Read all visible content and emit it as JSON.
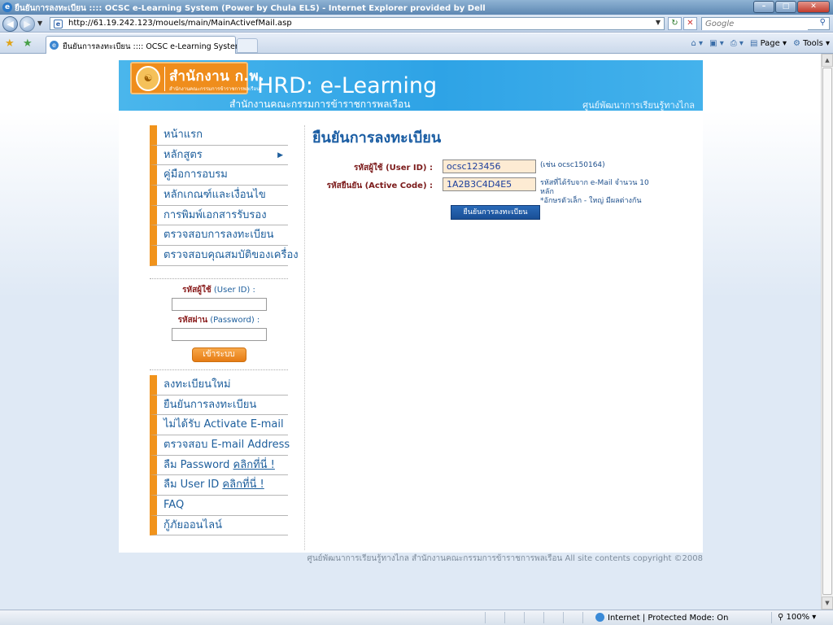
{
  "browser": {
    "window_title": "ยืนยันการลงทะเบียน :::: OCSC e-Learning System (Power by Chula ELS) - Internet Explorer provided by Dell",
    "url": "http://61.19.242.123/mouels/main/MainActivefMail.asp",
    "search_placeholder": "Google",
    "tab_title": "ยืนยันการลงทะเบียน :::: OCSC e-Learning System (...",
    "cmd_page": "Page",
    "cmd_tools": "Tools",
    "status_zone": "Internet | Protected Mode: On",
    "zoom": "100%"
  },
  "banner": {
    "logo_text": "สำนักงาน ก.พ.",
    "logo_subtext": "สำนักงานคณะกรรมการข้าราชการพลเรือน",
    "title": "HRD: e-Learning",
    "org": "สำนักงานคณะกรรมการข้าราชการพลเรือน",
    "center": "ศูนย์พัฒนาการเรียนรู้ทางไกล"
  },
  "sidebar": {
    "menu": [
      {
        "label": "หน้าแรก"
      },
      {
        "label": "หลักสูตร"
      },
      {
        "label": "คู่มือการอบรม"
      },
      {
        "label": "หลักเกณฑ์และเงื่อนไข"
      },
      {
        "label": "การพิมพ์เอกสารรับรอง"
      },
      {
        "label": "ตรวจสอบการลงทะเบียน"
      },
      {
        "label": "ตรวจสอบคุณสมบัติของเครื่อง"
      }
    ],
    "login": {
      "user_label_bold": "รหัสผู้ใช้",
      "user_label": " (User ID) :",
      "pass_label_bold": "รหัสผ่าน",
      "pass_label": " (Password) :",
      "button": "เข้าระบบ"
    },
    "menu2": [
      {
        "label": "ลงทะเบียนใหม่"
      },
      {
        "label": "ยืนยันการลงทะเบียน"
      },
      {
        "label": "ไม่ได้รับ Activate E-mail"
      },
      {
        "label": "ตรวจสอบ E-mail Address"
      },
      {
        "label": "ลืม Password ",
        "link": "คลิกที่นี่ !"
      },
      {
        "label": "ลืม User ID ",
        "link": "คลิกที่นี่ !"
      },
      {
        "label": "FAQ"
      },
      {
        "label": "กู้ภัยออนไลน์"
      }
    ]
  },
  "main": {
    "heading": "ยืนยันการลงทะเบียน",
    "user_label": "รหัสผู้ใช้ (User ID) :",
    "user_value": "ocsc123456",
    "user_hint": "(เช่น ocsc150164)",
    "code_label": "รหัสยืนยัน (Active Code) :",
    "code_value": "1A2B3C4D4E5",
    "code_hint_1": "รหัสที่ได้รับจาก e-Mail จำนวน 10",
    "code_hint_2": "หลัก",
    "code_hint_3": "*อักษรตัวเล็ก - ใหญ่ มีผลต่างกัน",
    "confirm_button": "ยืนยันการลงทะเบียน"
  },
  "footer": "ศูนย์พัฒนาการเรียนรู้ทางไกล สำนักงานคณะกรรมการข้าราชการพลเรือน All site contents copyright ©2008"
}
